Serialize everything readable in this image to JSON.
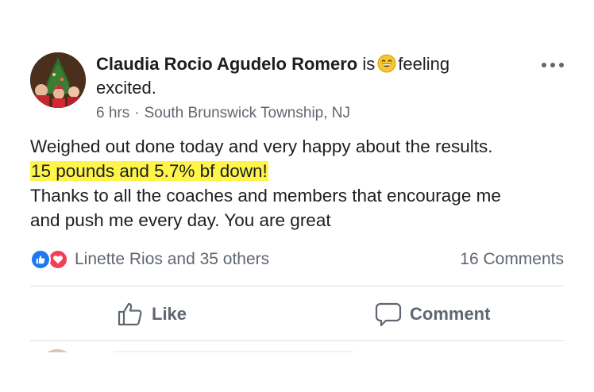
{
  "post": {
    "author": "Claudia Rocio Agudelo Romero",
    "verb": "is",
    "feeling_word": "feeling",
    "feeling_value": "excited.",
    "feeling_icon": "grinning-face-icon",
    "time": "6 hrs",
    "separator": "·",
    "location": "South Brunswick Township, NJ",
    "more_icon": "more-options-icon",
    "body": {
      "line1": "Weighed out done today and  very happy about the results.",
      "highlight": "15 pounds and 5.7% bf down!",
      "line3": "Thanks to all the coaches and  members that encourage me",
      "line4": "and push me every day.  You are great"
    },
    "reactions": {
      "icons": [
        "like-reaction-icon",
        "love-reaction-icon"
      ],
      "text": "Linette Rios and 35 others"
    },
    "comments_count": "16 Comments",
    "actions": {
      "like_label": "Like",
      "comment_label": "Comment"
    }
  },
  "colors": {
    "highlight": "#fef44a",
    "like_blue": "#2078f4",
    "love_red": "#f33e58",
    "secondary_text": "#606770"
  }
}
